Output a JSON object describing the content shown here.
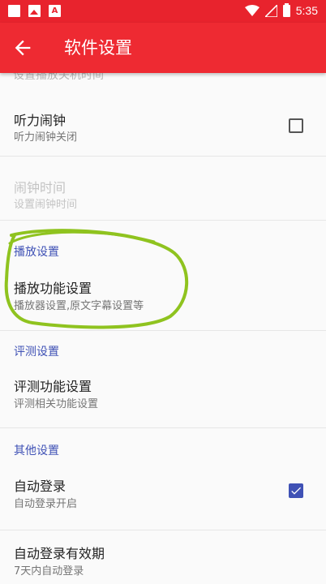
{
  "status_bar": {
    "time": "5:35",
    "icons": [
      "square-notification-icon",
      "photo-icon",
      "text-notification-icon",
      "wifi-icon",
      "signal-icon",
      "battery-charging-icon"
    ]
  },
  "app_bar": {
    "title": "软件设置",
    "back_icon": "arrow-back-icon"
  },
  "partial_item": {
    "text": "设置播放关机时间"
  },
  "items": [
    {
      "title": "听力闹钟",
      "summary": "听力闹钟关闭",
      "checked": false,
      "enabled": true
    },
    {
      "title": "闹钟时间",
      "summary": "设置闹钟时间",
      "enabled": false
    }
  ],
  "sections": [
    {
      "header": "播放设置",
      "item": {
        "title": "播放功能设置",
        "summary": "播放器设置,原文字幕设置等"
      }
    },
    {
      "header": "评测设置",
      "item": {
        "title": "评测功能设置",
        "summary": "评测相关功能设置"
      }
    },
    {
      "header": "其他设置",
      "items": [
        {
          "title": "自动登录",
          "summary": "自动登录开启",
          "checked": true
        },
        {
          "title": "自动登录有效期",
          "summary": "7天内自动登录"
        }
      ]
    }
  ],
  "colors": {
    "app_bar": "#ee2a32",
    "status_bar": "#e8232d",
    "accent": "#3f51b5",
    "annotation": "#8fc31f"
  }
}
